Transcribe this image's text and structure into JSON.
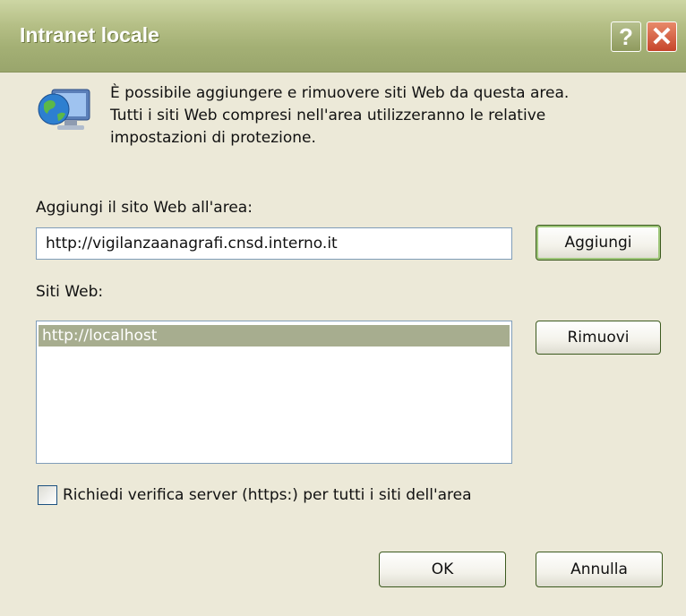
{
  "window": {
    "title": "Intranet locale",
    "help_glyph": "?",
    "close_glyph": "✕"
  },
  "icon": "globe-computer-icon",
  "description": {
    "line1": "È possibile aggiungere e rimuovere siti Web da questa area.",
    "line2": "Tutti i siti Web compresi nell'area utilizzeranno le relative",
    "line3": "impostazioni di protezione."
  },
  "add_site": {
    "label": "Aggiungi il sito Web all'area:",
    "value": "http://vigilanzaanagrafi.cnsd.interno.it",
    "button": "Aggiungi"
  },
  "sites": {
    "label": "Siti Web:",
    "items": [
      "http://localhost"
    ],
    "remove_button": "Rimuovi"
  },
  "verify": {
    "label": "Richiedi verifica server (https:) per tutti i siti dell'area",
    "checked": false
  },
  "footer": {
    "ok": "OK",
    "cancel": "Annulla"
  },
  "colors": {
    "titlebar": "#a4b075",
    "dialog_bg": "#ece9d8",
    "selection": "#a7ad8f",
    "close": "#c6452b"
  }
}
